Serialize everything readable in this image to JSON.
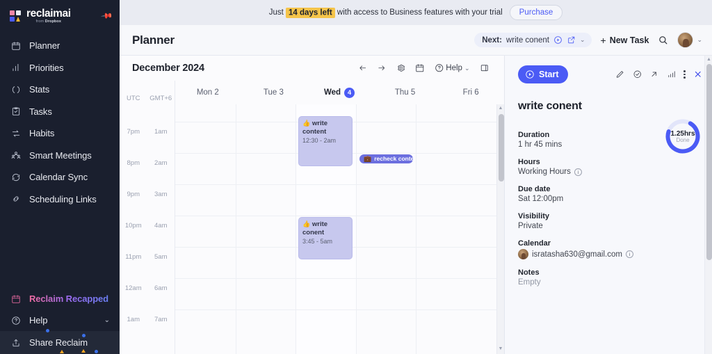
{
  "sidebar": {
    "brand": {
      "name": "reclaimai",
      "sub_prefix": "from ",
      "sub_brand": "Dropbox"
    },
    "pin_icon": "pin-icon",
    "items": [
      {
        "label": "Planner",
        "icon": "calendar-icon"
      },
      {
        "label": "Priorities",
        "icon": "bar-chart-icon"
      },
      {
        "label": "Stats",
        "icon": "circle-dashed-icon"
      },
      {
        "label": "Tasks",
        "icon": "clipboard-check-icon"
      },
      {
        "label": "Habits",
        "icon": "repeat-icon"
      },
      {
        "label": "Smart Meetings",
        "icon": "people-group-icon"
      },
      {
        "label": "Calendar Sync",
        "icon": "refresh-icon"
      },
      {
        "label": "Scheduling Links",
        "icon": "link-icon"
      }
    ],
    "bottom": [
      {
        "label": "Reclaim Recapped",
        "icon": "calendar-recap-icon"
      },
      {
        "label": "Help",
        "icon": "help-circle-icon",
        "chevron": "⌄"
      },
      {
        "label": "Share Reclaim",
        "icon": "share-upload-icon"
      }
    ]
  },
  "banner": {
    "prefix": "Just",
    "highlight": "14 days left",
    "suffix": "with access to Business features with your trial",
    "purchase_label": "Purchase",
    "highlight_color": "#f5c44a"
  },
  "header": {
    "title": "Planner",
    "next_label": "Next:",
    "next_task": "write conent",
    "new_task_label": "New Task",
    "plus": "+",
    "chevron": "⌄"
  },
  "calendar": {
    "month": "December 2024",
    "help_label": "Help",
    "timezones": [
      "UTC",
      "GMT+6"
    ],
    "days": [
      {
        "label": "Mon 2",
        "name": "Mon",
        "num": "2",
        "today": false
      },
      {
        "label": "Tue 3",
        "name": "Tue",
        "num": "3",
        "today": false
      },
      {
        "label": "Wed 4",
        "name": "Wed",
        "num": "4",
        "today": true
      },
      {
        "label": "Thu 5",
        "name": "Thu",
        "num": "5",
        "today": false
      },
      {
        "label": "Fri 6",
        "name": "Fri",
        "num": "6",
        "today": false
      }
    ],
    "times": [
      {
        "left": "7pm",
        "right": "1am"
      },
      {
        "left": "8pm",
        "right": "2am"
      },
      {
        "left": "9pm",
        "right": "3am"
      },
      {
        "left": "10pm",
        "right": "4am"
      },
      {
        "left": "11pm",
        "right": "5am"
      },
      {
        "left": "12am",
        "right": "6am"
      },
      {
        "left": "1am",
        "right": "7am"
      }
    ],
    "events": [
      {
        "emoji": "👍",
        "title": "write content",
        "time": "12:30 - 2am",
        "day": 2,
        "color": "#c7c8ee"
      },
      {
        "emoji": "💼",
        "title": "recheck conten",
        "time": "",
        "day": 3,
        "color": "#6c6fdf",
        "bar": true
      },
      {
        "emoji": "👍",
        "title": "write conent",
        "time": "3:45 - 5am",
        "day": 2,
        "color": "#c7c8ee"
      }
    ]
  },
  "panel": {
    "start_label": "Start",
    "actions": [
      "edit-icon",
      "check-circle-icon",
      "open-external-icon",
      "stats-icon",
      "more-icon",
      "close-icon"
    ],
    "title": "write conent",
    "fields": [
      {
        "label": "Duration",
        "value": "1 hr 45 mins",
        "info": false
      },
      {
        "label": "Hours",
        "value": "Working Hours",
        "info": true
      },
      {
        "label": "Due date",
        "value": "Sat 12:00pm",
        "info": false
      },
      {
        "label": "Visibility",
        "value": "Private",
        "info": false
      },
      {
        "label": "Calendar",
        "value": "isratasha630@gmail.com",
        "info": true,
        "avatar": true
      },
      {
        "label": "Notes",
        "value": "Empty",
        "info": false,
        "muted": true
      }
    ],
    "progress": {
      "value": "1.25hrs",
      "sub": "Done",
      "percent": 72,
      "color": "#4b5bf5",
      "track": "#e2e5fa"
    }
  }
}
